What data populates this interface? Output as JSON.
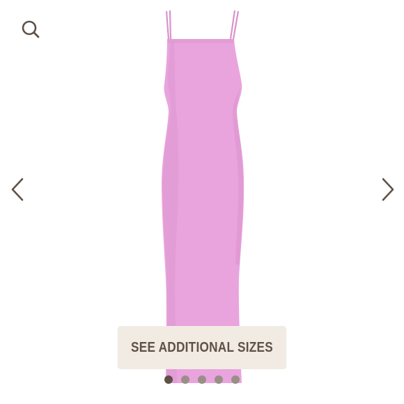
{
  "product": {
    "image_name": "pink-slip-maxi-dress",
    "dress_color": "#e9a4dd"
  },
  "toolbar": {
    "search_icon": "search-icon"
  },
  "carousel": {
    "prev_icon": "chevron-left-icon",
    "next_icon": "chevron-right-icon",
    "slide_count": 5,
    "active_slide": 1
  },
  "sizes_button": {
    "label": "SEE ADDITIONAL SIZES"
  },
  "colors": {
    "icon": "#5e5148",
    "button_bg": "#f1ebe3",
    "button_text": "#5e5148",
    "dot_active": "#5e5148",
    "dot_inactive": "#9a8f88"
  }
}
